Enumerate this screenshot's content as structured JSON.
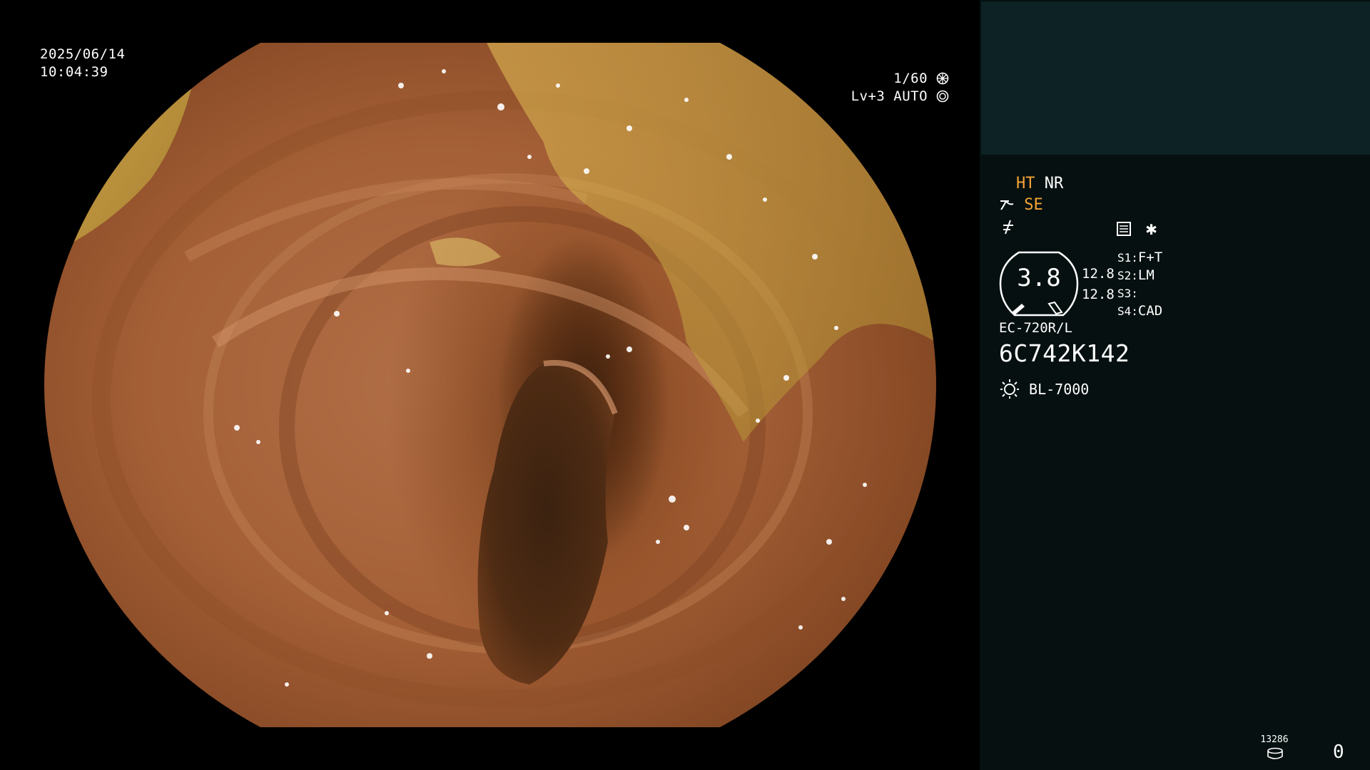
{
  "capture": {
    "date": "2025/06/14",
    "time": "10:04:39"
  },
  "exposure": {
    "shutter": "1/60",
    "level": "Lv+3",
    "mode": "AUTO"
  },
  "image_modes": {
    "ht": "HT",
    "nr": "NR",
    "se": "SE"
  },
  "gauge": {
    "value": "3.8",
    "values_right": [
      "12.8",
      "12.8"
    ]
  },
  "switches": [
    {
      "key": "S1:",
      "value": "F+T"
    },
    {
      "key": "S2:",
      "value": "LM"
    },
    {
      "key": "S3:",
      "value": ""
    },
    {
      "key": "S4:",
      "value": "CAD"
    }
  ],
  "scope": {
    "model": "EC-720R/L",
    "serial": "6C742K142"
  },
  "light_source": "BL-7000",
  "storage": {
    "count": "13286",
    "index": "0"
  },
  "colors": {
    "accent": "#f6a436",
    "panel_bg": "#061010",
    "preview_bg": "#0c2224"
  }
}
